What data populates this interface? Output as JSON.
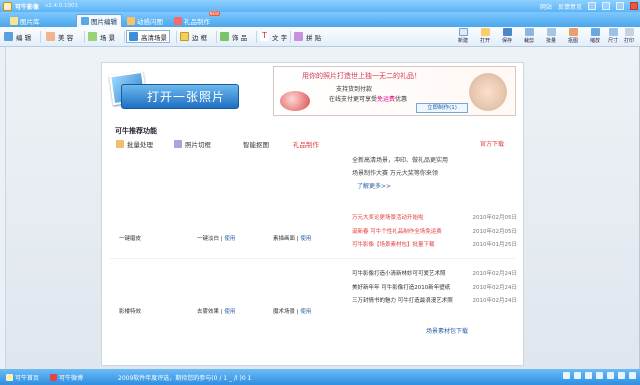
{
  "app": {
    "name": "可牛影像",
    "version": "v2.4.0.1001",
    "top_links": [
      "网站",
      "反馈意见"
    ]
  },
  "tabs": [
    {
      "label": "图片库"
    },
    {
      "label": "图片编辑"
    },
    {
      "label": "动感闪图"
    },
    {
      "label": "礼品制作",
      "badge": "NEW"
    }
  ],
  "toolbar": {
    "tools": [
      "编 辑",
      "美 容",
      "场 景",
      "高清场景",
      "边 框",
      "饰 品",
      "文 字",
      "拼 贴"
    ],
    "right": [
      "新建",
      "打开",
      "保存",
      "裁剪",
      "批量",
      "抠图",
      "缩放",
      "尺寸",
      "打印"
    ]
  },
  "main": {
    "open_button": "打开一张照片",
    "ad": {
      "line1": "用你的照片打造世上独一无二的礼品！",
      "line2": "支持货到付款",
      "line3_prefix": "在线支付更可享受",
      "line3_highlight": "免运费",
      "line3_suffix": "优惠",
      "cta": "立即制作(1)"
    },
    "section_title": "可牛推荐功能",
    "features": [
      {
        "label": "批量处理"
      },
      {
        "label": "照片切框"
      },
      {
        "label": "智能抠图"
      },
      {
        "label": "礼品制作"
      }
    ],
    "official_download": "官方下载",
    "intro": [
      "全新高清场景，冲印、做礼品更实用",
      "场景制作大赛 万元大奖等你来领"
    ],
    "more": "了解更多>>",
    "news": [
      {
        "text": "万元大奖论更场景活动开始啦",
        "date": "2010年02月05日",
        "style": "red"
      },
      {
        "text": "诞新春 可牛个性礼品制作全场免运费",
        "date": "2010年02月05日",
        "style": "red"
      },
      {
        "text": "可牛影像【场景素材包】批量下载",
        "date": "2010年01月25日",
        "style": "red"
      },
      {
        "text": "可牛影像打造小清新林妙可可爱艺术照",
        "date": "2010年02月24日",
        "style": "blk"
      },
      {
        "text": "美好新年年 可牛影像打造2010新年壁纸",
        "date": "2010年02月24日",
        "style": "blk"
      },
      {
        "text": "三万封情书的魅力 可牛打造最浪漫艺术照",
        "date": "2010年02月24日",
        "style": "blk"
      }
    ],
    "row1": {
      "c1": "一键磨皮",
      "c2": "一键淡白",
      "c2_link": "使用",
      "c3": "素描画面",
      "c3_link": "使用"
    },
    "row2": {
      "c1": "影楼特效",
      "c2": "去雾效果",
      "c2_link": "使用",
      "c3": "魔术场景",
      "c3_link": "使用"
    },
    "scene_download": "场景素材包下载"
  },
  "status": {
    "home": "可牛首页",
    "weibo": "可牛微博",
    "ticker": "2009软件年度评选，期待您的参与(0 / 1 _ /l )0 1"
  },
  "colors": {
    "accent": "#4aa6ec",
    "red_link": "#e23b3b",
    "blue_link": "#2a5ca8"
  }
}
